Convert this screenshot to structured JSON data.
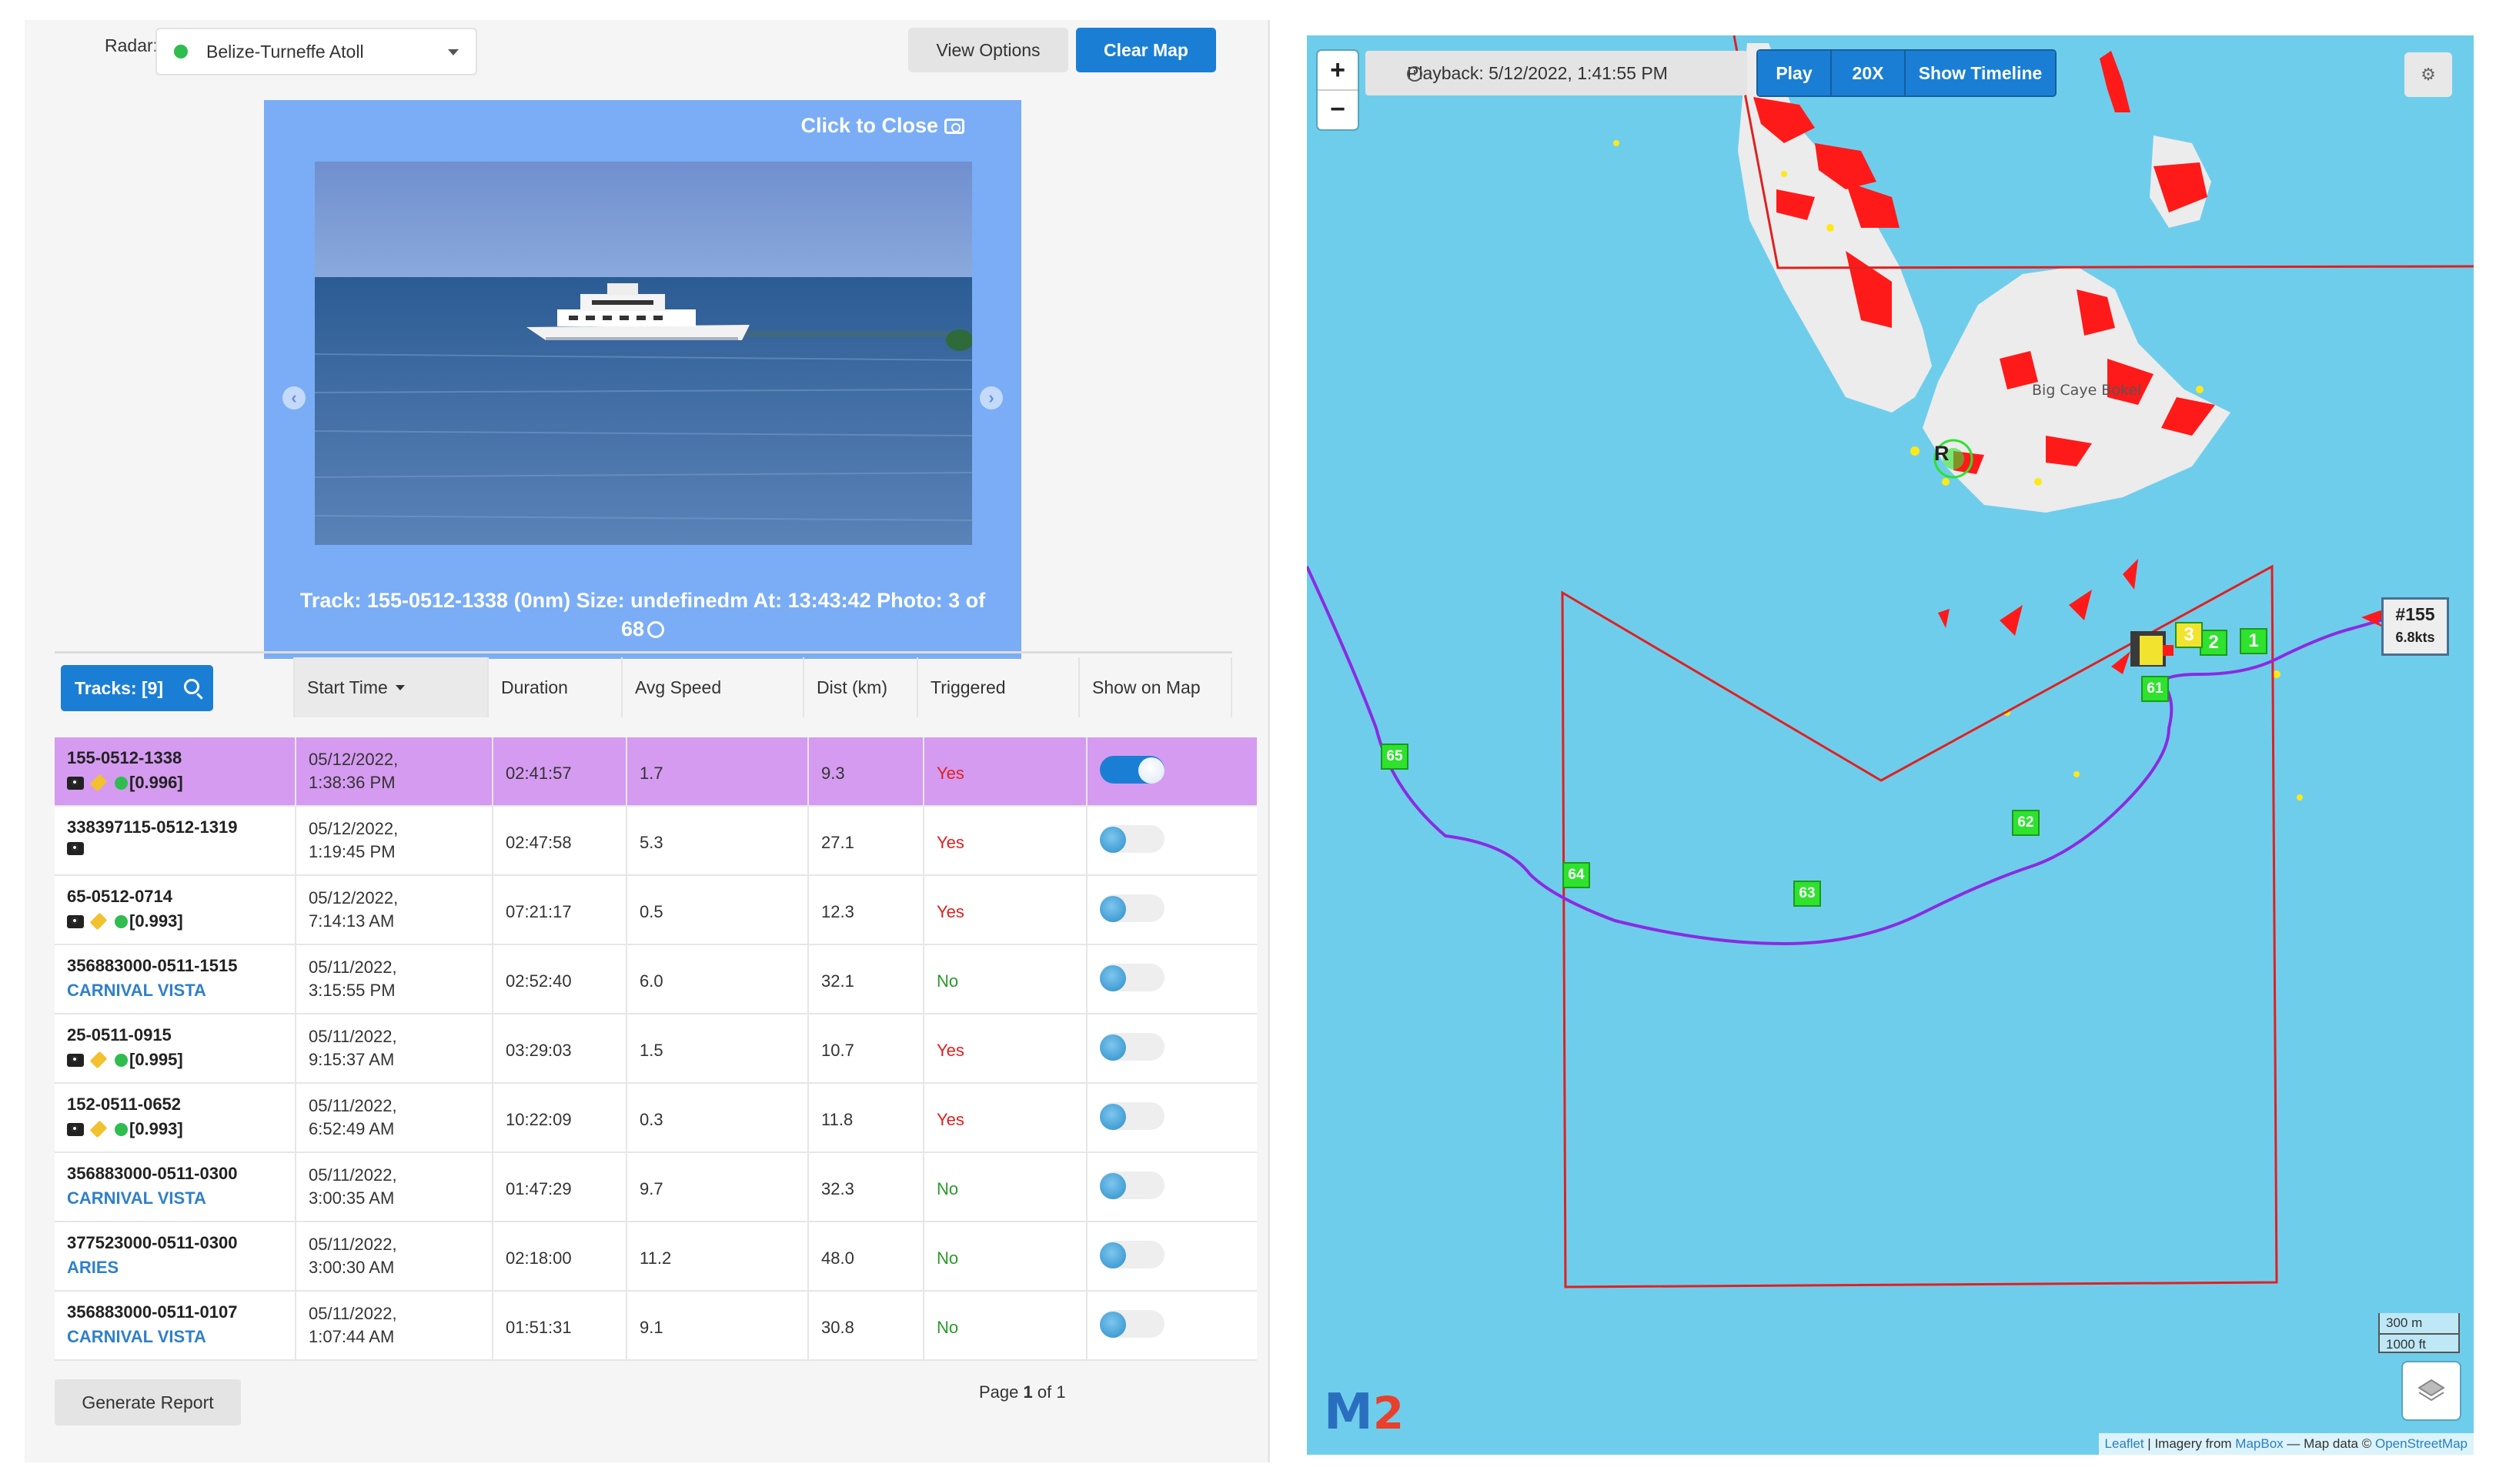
{
  "radar": {
    "label": "Radar:",
    "selected": "Belize-Turneffe Atoll",
    "status_color": "#2ebd4e"
  },
  "toolbar": {
    "view_options": "View Options",
    "clear_map": "Clear Map"
  },
  "photo_viewer": {
    "close_label": "Click to Close",
    "caption_line1": "Track: 155-0512-1338 (0nm) Size: undefinedm At: 13:43:42 Photo: 3 of",
    "caption_line2": "68",
    "prev_icon": "chevron-left-icon",
    "next_icon": "chevron-right-icon"
  },
  "table": {
    "tracks_button": "Tracks: [9]",
    "headers": {
      "start_time": "Start Time",
      "duration": "Duration",
      "avg_speed": "Avg Speed",
      "dist": "Dist (km)",
      "triggered": "Triggered",
      "show_on_map": "Show on Map"
    },
    "rows": [
      {
        "id": "155-0512-1338",
        "vessel": "",
        "camera": true,
        "tag": true,
        "score": "[0.996]",
        "start_date": "05/12/2022,",
        "start_time": "1:38:36 PM",
        "duration": "02:41:57",
        "avg_speed": "1.7",
        "dist": "9.3",
        "triggered": "Yes",
        "show_on_map": true,
        "selected": true
      },
      {
        "id": "338397115-0512-1319",
        "vessel": "",
        "camera": true,
        "tag": false,
        "score": "",
        "start_date": "05/12/2022,",
        "start_time": "1:19:45 PM",
        "duration": "02:47:58",
        "avg_speed": "5.3",
        "dist": "27.1",
        "triggered": "Yes",
        "show_on_map": false,
        "selected": false
      },
      {
        "id": "65-0512-0714",
        "vessel": "",
        "camera": true,
        "tag": true,
        "score": "[0.993]",
        "start_date": "05/12/2022,",
        "start_time": "7:14:13 AM",
        "duration": "07:21:17",
        "avg_speed": "0.5",
        "dist": "12.3",
        "triggered": "Yes",
        "show_on_map": false,
        "selected": false
      },
      {
        "id": "356883000-0511-1515",
        "vessel": "CARNIVAL VISTA",
        "camera": false,
        "tag": false,
        "score": "",
        "start_date": "05/11/2022,",
        "start_time": "3:15:55 PM",
        "duration": "02:52:40",
        "avg_speed": "6.0",
        "dist": "32.1",
        "triggered": "No",
        "show_on_map": false,
        "selected": false
      },
      {
        "id": "25-0511-0915",
        "vessel": "",
        "camera": true,
        "tag": true,
        "score": "[0.995]",
        "start_date": "05/11/2022,",
        "start_time": "9:15:37 AM",
        "duration": "03:29:03",
        "avg_speed": "1.5",
        "dist": "10.7",
        "triggered": "Yes",
        "show_on_map": false,
        "selected": false
      },
      {
        "id": "152-0511-0652",
        "vessel": "",
        "camera": true,
        "tag": true,
        "score": "[0.993]",
        "start_date": "05/11/2022,",
        "start_time": "6:52:49 AM",
        "duration": "10:22:09",
        "avg_speed": "0.3",
        "dist": "11.8",
        "triggered": "Yes",
        "show_on_map": false,
        "selected": false
      },
      {
        "id": "356883000-0511-0300",
        "vessel": "CARNIVAL VISTA",
        "camera": false,
        "tag": false,
        "score": "",
        "start_date": "05/11/2022,",
        "start_time": "3:00:35 AM",
        "duration": "01:47:29",
        "avg_speed": "9.7",
        "dist": "32.3",
        "triggered": "No",
        "show_on_map": false,
        "selected": false
      },
      {
        "id": "377523000-0511-0300",
        "vessel": "ARIES",
        "camera": false,
        "tag": false,
        "score": "",
        "start_date": "05/11/2022,",
        "start_time": "3:00:30 AM",
        "duration": "02:18:00",
        "avg_speed": "11.2",
        "dist": "48.0",
        "triggered": "No",
        "show_on_map": false,
        "selected": false
      },
      {
        "id": "356883000-0511-0107",
        "vessel": "CARNIVAL VISTA",
        "camera": false,
        "tag": false,
        "score": "",
        "start_date": "05/11/2022,",
        "start_time": "1:07:44 AM",
        "duration": "01:51:31",
        "avg_speed": "9.1",
        "dist": "30.8",
        "triggered": "No",
        "show_on_map": false,
        "selected": false
      }
    ],
    "generate_report": "Generate Report",
    "pager": {
      "prefix": "Page",
      "current": "1",
      "middle": "of",
      "total": "1"
    }
  },
  "map": {
    "zoom_in": "+",
    "zoom_out": "−",
    "playback": "Playback: 5/12/2022, 1:41:55 PM",
    "play": "Play",
    "speed": "20X",
    "show_timeline": "Show Timeline",
    "settings_icon": "settings-icon",
    "scale_m": "300 m",
    "scale_ft": "1000 ft",
    "logo": "M2",
    "island_label": "Big Caye Bokel",
    "radar_marker": "R",
    "track_card": {
      "number": "#155",
      "speed": "6.8kts"
    },
    "markers": [
      "65",
      "64",
      "63",
      "62",
      "61",
      "1",
      "2",
      "3"
    ],
    "attribution": {
      "leaflet": "Leaflet",
      "sep1": " | Imagery from ",
      "mapbox": "MapBox",
      "sep2": " — Map data © ",
      "osm": "OpenStreetMap"
    },
    "track_color": "#8a2be2",
    "zone_color": "#e02020",
    "marker_color": "#2ee22e"
  }
}
